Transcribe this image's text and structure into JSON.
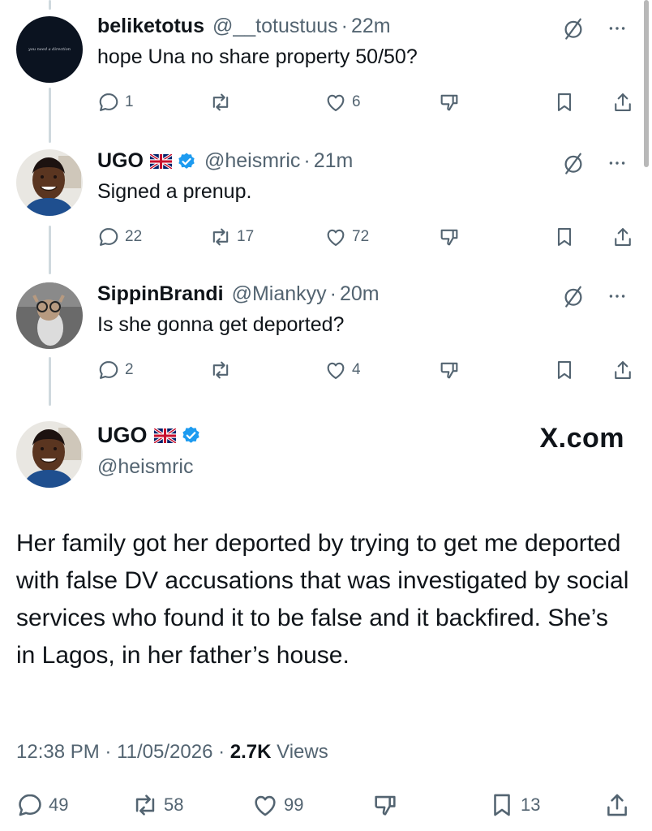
{
  "replies": [
    {
      "name": "beliketotus",
      "handle": "@__totustuus",
      "time": "22m",
      "text": "hope Una no share property 50/50?",
      "avatar_text": "you need a direction",
      "replies": "1",
      "retweets": "",
      "likes": "6"
    },
    {
      "name": "UGO",
      "handle": "@heismric",
      "time": "21m",
      "text": "Signed a prenup.",
      "replies": "22",
      "retweets": "17",
      "likes": "72"
    },
    {
      "name": "SippinBrandi",
      "handle": "@Miankyy",
      "time": "20m",
      "text": "Is she gonna get deported?",
      "replies": "2",
      "retweets": "",
      "likes": "4"
    }
  ],
  "main": {
    "name": "UGO",
    "handle": "@heismric",
    "site": "X.com",
    "text": "Her family got her deported by trying to get me deported with false DV accusations that was investigated by social services who found it to be false and it backfired. She’s in Lagos, in her father’s house.",
    "time": "12:38 PM",
    "date": "11/05/2026",
    "views": "2.7K",
    "views_label": "Views",
    "replies": "49",
    "retweets": "58",
    "likes": "99",
    "bookmarks": "13"
  },
  "colors": {
    "text": "#0f1419",
    "muted": "#536471",
    "verified": "#1d9bf0",
    "line": "#cfd9de"
  },
  "icons": [
    "reply-icon",
    "retweet-icon",
    "like-icon",
    "dislike-icon",
    "bookmark-icon",
    "share-icon",
    "mute-icon",
    "more-icon",
    "verified-icon",
    "uk-flag-icon"
  ]
}
